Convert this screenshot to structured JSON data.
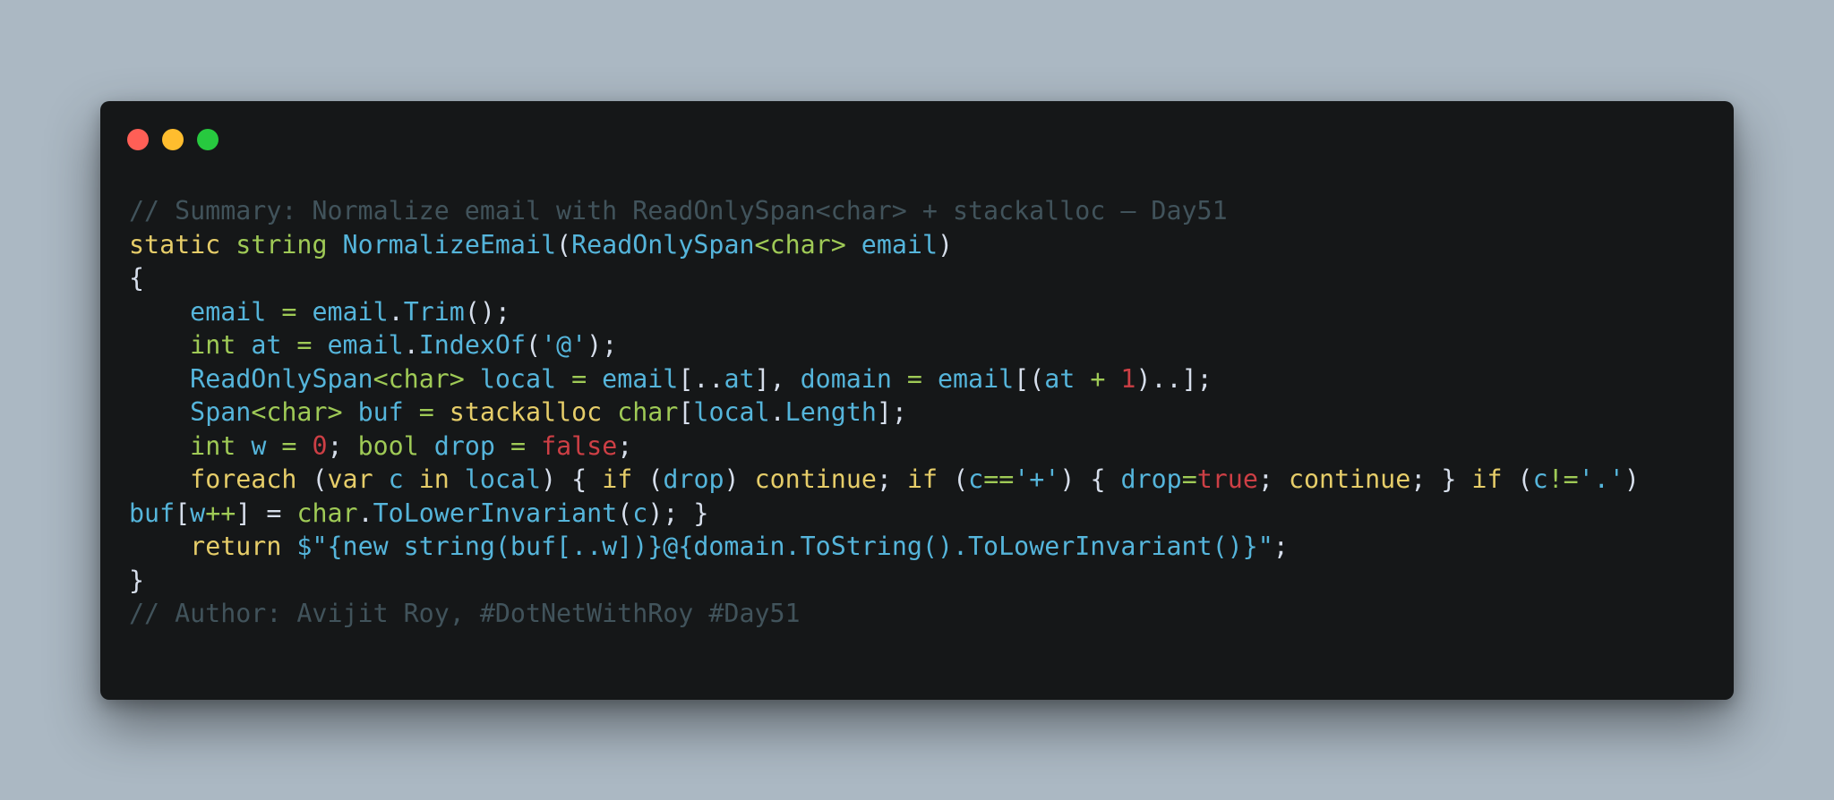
{
  "window": {
    "dots": [
      {
        "name": "close",
        "color": "#ff5f56"
      },
      {
        "name": "minimize",
        "color": "#ffbd2e"
      },
      {
        "name": "maximize",
        "color": "#27c93f"
      }
    ]
  },
  "colors": {
    "background": "#abb8c3",
    "editor": "#151718",
    "comment": "#41535b",
    "keyword": "#e6cd69",
    "type": "#9fca56",
    "identifier": "#55b5db",
    "punctuation": "#d6deeb",
    "number": "#cd3f45"
  },
  "code_lines": [
    [
      {
        "t": "// Summary: Normalize email with ReadOnlySpan<char> + stackalloc — Day51",
        "c": "comment"
      }
    ],
    [
      {
        "t": "static",
        "c": "keyword"
      },
      {
        "t": " ",
        "c": "punct"
      },
      {
        "t": "string",
        "c": "type"
      },
      {
        "t": " ",
        "c": "punct"
      },
      {
        "t": "NormalizeEmail",
        "c": "ident"
      },
      {
        "t": "(",
        "c": "punct"
      },
      {
        "t": "ReadOnlySpan",
        "c": "ident"
      },
      {
        "t": "<char>",
        "c": "type"
      },
      {
        "t": " ",
        "c": "punct"
      },
      {
        "t": "email",
        "c": "ident"
      },
      {
        "t": ")",
        "c": "punct"
      }
    ],
    [
      {
        "t": "{",
        "c": "punct"
      }
    ],
    [
      {
        "t": "    ",
        "c": "punct"
      },
      {
        "t": "email",
        "c": "ident"
      },
      {
        "t": " = ",
        "c": "op"
      },
      {
        "t": "email",
        "c": "ident"
      },
      {
        "t": ".",
        "c": "punct"
      },
      {
        "t": "Trim",
        "c": "ident"
      },
      {
        "t": "();",
        "c": "punct"
      }
    ],
    [
      {
        "t": "    ",
        "c": "punct"
      },
      {
        "t": "int",
        "c": "type"
      },
      {
        "t": " ",
        "c": "punct"
      },
      {
        "t": "at",
        "c": "ident"
      },
      {
        "t": " = ",
        "c": "op"
      },
      {
        "t": "email",
        "c": "ident"
      },
      {
        "t": ".",
        "c": "punct"
      },
      {
        "t": "IndexOf",
        "c": "ident"
      },
      {
        "t": "(",
        "c": "punct"
      },
      {
        "t": "'@'",
        "c": "string"
      },
      {
        "t": ");",
        "c": "punct"
      }
    ],
    [
      {
        "t": "    ",
        "c": "punct"
      },
      {
        "t": "ReadOnlySpan",
        "c": "ident"
      },
      {
        "t": "<char>",
        "c": "type"
      },
      {
        "t": " ",
        "c": "punct"
      },
      {
        "t": "local",
        "c": "ident"
      },
      {
        "t": " = ",
        "c": "op"
      },
      {
        "t": "email",
        "c": "ident"
      },
      {
        "t": "[..",
        "c": "punct"
      },
      {
        "t": "at",
        "c": "ident"
      },
      {
        "t": "], ",
        "c": "punct"
      },
      {
        "t": "domain",
        "c": "ident"
      },
      {
        "t": " = ",
        "c": "op"
      },
      {
        "t": "email",
        "c": "ident"
      },
      {
        "t": "[(",
        "c": "punct"
      },
      {
        "t": "at",
        "c": "ident"
      },
      {
        "t": " + ",
        "c": "op"
      },
      {
        "t": "1",
        "c": "number"
      },
      {
        "t": ")..];",
        "c": "punct"
      }
    ],
    [
      {
        "t": "    ",
        "c": "punct"
      },
      {
        "t": "Span",
        "c": "ident"
      },
      {
        "t": "<char>",
        "c": "type"
      },
      {
        "t": " ",
        "c": "punct"
      },
      {
        "t": "buf",
        "c": "ident"
      },
      {
        "t": " = ",
        "c": "op"
      },
      {
        "t": "stackalloc",
        "c": "keyword"
      },
      {
        "t": " ",
        "c": "punct"
      },
      {
        "t": "char",
        "c": "type"
      },
      {
        "t": "[",
        "c": "punct"
      },
      {
        "t": "local",
        "c": "ident"
      },
      {
        "t": ".",
        "c": "punct"
      },
      {
        "t": "Length",
        "c": "ident"
      },
      {
        "t": "];",
        "c": "punct"
      }
    ],
    [
      {
        "t": "    ",
        "c": "punct"
      },
      {
        "t": "int",
        "c": "type"
      },
      {
        "t": " ",
        "c": "punct"
      },
      {
        "t": "w",
        "c": "ident"
      },
      {
        "t": " = ",
        "c": "op"
      },
      {
        "t": "0",
        "c": "number"
      },
      {
        "t": "; ",
        "c": "punct"
      },
      {
        "t": "bool",
        "c": "type"
      },
      {
        "t": " ",
        "c": "punct"
      },
      {
        "t": "drop",
        "c": "ident"
      },
      {
        "t": " = ",
        "c": "op"
      },
      {
        "t": "false",
        "c": "number"
      },
      {
        "t": ";",
        "c": "punct"
      }
    ],
    [
      {
        "t": "    ",
        "c": "punct"
      },
      {
        "t": "foreach",
        "c": "keyword"
      },
      {
        "t": " (",
        "c": "punct"
      },
      {
        "t": "var",
        "c": "keyword"
      },
      {
        "t": " ",
        "c": "punct"
      },
      {
        "t": "c",
        "c": "ident"
      },
      {
        "t": " ",
        "c": "punct"
      },
      {
        "t": "in",
        "c": "keyword"
      },
      {
        "t": " ",
        "c": "punct"
      },
      {
        "t": "local",
        "c": "ident"
      },
      {
        "t": ") { ",
        "c": "punct"
      },
      {
        "t": "if",
        "c": "keyword"
      },
      {
        "t": " (",
        "c": "punct"
      },
      {
        "t": "drop",
        "c": "ident"
      },
      {
        "t": ") ",
        "c": "punct"
      },
      {
        "t": "continue",
        "c": "keyword"
      },
      {
        "t": "; ",
        "c": "punct"
      },
      {
        "t": "if",
        "c": "keyword"
      },
      {
        "t": " (",
        "c": "punct"
      },
      {
        "t": "c",
        "c": "ident"
      },
      {
        "t": "==",
        "c": "op"
      },
      {
        "t": "'+'",
        "c": "string"
      },
      {
        "t": ") { ",
        "c": "punct"
      },
      {
        "t": "drop",
        "c": "ident"
      },
      {
        "t": "=",
        "c": "op"
      },
      {
        "t": "true",
        "c": "number"
      },
      {
        "t": "; ",
        "c": "punct"
      },
      {
        "t": "continue",
        "c": "keyword"
      },
      {
        "t": "; } ",
        "c": "punct"
      },
      {
        "t": "if",
        "c": "keyword"
      },
      {
        "t": " (",
        "c": "punct"
      },
      {
        "t": "c",
        "c": "ident"
      },
      {
        "t": "!=",
        "c": "op"
      },
      {
        "t": "'.'",
        "c": "string"
      },
      {
        "t": ")",
        "c": "punct"
      }
    ],
    [
      {
        "t": "buf",
        "c": "ident"
      },
      {
        "t": "[",
        "c": "punct"
      },
      {
        "t": "w",
        "c": "ident"
      },
      {
        "t": "++",
        "c": "op"
      },
      {
        "t": "] = ",
        "c": "punct"
      },
      {
        "t": "char",
        "c": "type"
      },
      {
        "t": ".",
        "c": "punct"
      },
      {
        "t": "ToLowerInvariant",
        "c": "ident"
      },
      {
        "t": "(",
        "c": "punct"
      },
      {
        "t": "c",
        "c": "ident"
      },
      {
        "t": "); }",
        "c": "punct"
      }
    ],
    [
      {
        "t": "    ",
        "c": "punct"
      },
      {
        "t": "return",
        "c": "keyword"
      },
      {
        "t": " ",
        "c": "punct"
      },
      {
        "t": "$\"{new string(buf[..w])}@{domain.ToString().ToLowerInvariant()}\"",
        "c": "string"
      },
      {
        "t": ";",
        "c": "punct"
      }
    ],
    [
      {
        "t": "}",
        "c": "punct"
      }
    ],
    [
      {
        "t": "// Author: Avijit Roy, #DotNetWithRoy #Day51",
        "c": "comment"
      }
    ]
  ]
}
